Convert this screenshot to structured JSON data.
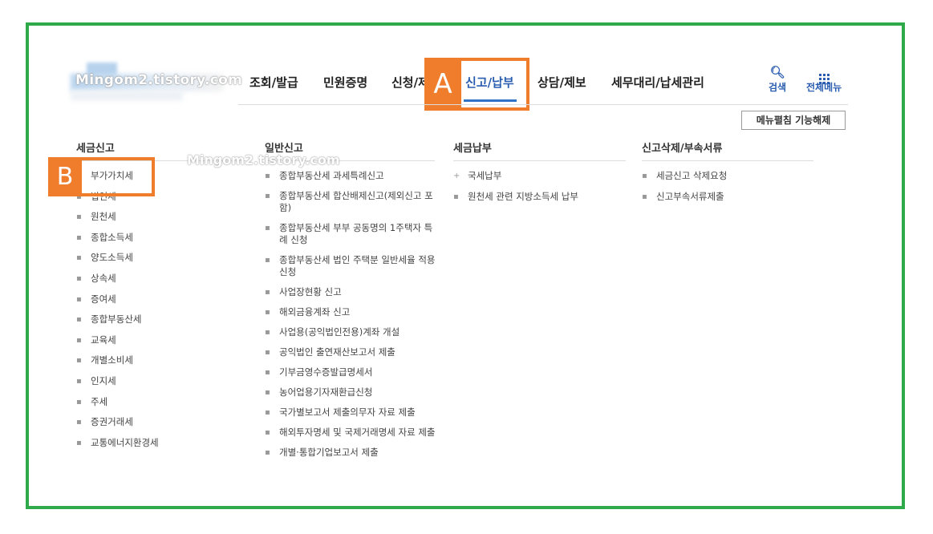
{
  "header": {
    "watermark": "Mingom2.tistory.com",
    "nav": [
      "조회/발급",
      "민원증명",
      "신청/제",
      "신고/납부",
      "상담/제보",
      "세무대리/납세관리"
    ],
    "search_label": "검색",
    "all_menu_label": "전체메뉴",
    "menu_close_label": "메뉴펼침 기능해제",
    "annotation_a": "A",
    "annotation_b": "B"
  },
  "columns": [
    {
      "title": "세금신고",
      "items": [
        "부가가치세",
        "법인세",
        "원천세",
        "종합소득세",
        "양도소득세",
        "상속세",
        "증여세",
        "종합부동산세",
        "교육세",
        "개별소비세",
        "인지세",
        "주세",
        "증권거래세",
        "교통에너지환경세"
      ]
    },
    {
      "title": "일반신고",
      "items": [
        "종합부동산세 과세특례신고",
        "종합부동산세 합산배제신고(제외신고 포함)",
        "종합부동산세 부부 공동명의 1주택자 특례 신청",
        "종합부동산세 법인 주택분 일반세율 적용 신청",
        "사업장현황 신고",
        "해외금융계좌 신고",
        "사업용(공익법인전용)계좌 개설",
        "공익법인 출연재산보고서 제출",
        "기부금영수증발급명세서",
        "농어업용기자재환급신청",
        "국가별보고서 제출의무자 자료 제출",
        "해외투자명세 및 국제거래명세 자료 제출",
        "개별·통합기업보고서 제출"
      ]
    },
    {
      "title": "세금납부",
      "items": [
        "국세납부",
        "원천세 관련 지방소득세 납부"
      ]
    },
    {
      "title": "신고삭제/부속서류",
      "items": [
        "세금신고 삭제요청",
        "신고부속서류제출"
      ]
    }
  ],
  "colors": {
    "frame": "#2eaa4a",
    "annotation": "#f07d2c",
    "active": "#2a5db0"
  }
}
